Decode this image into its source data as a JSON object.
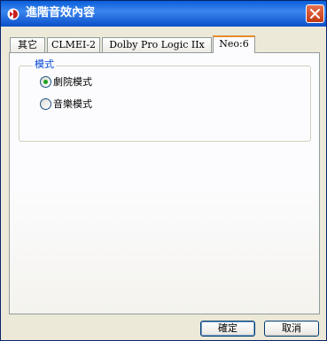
{
  "window": {
    "title": "進階音效內容"
  },
  "tabs": [
    {
      "label": "其它",
      "active": false
    },
    {
      "label": "CLMEI-2",
      "active": false
    },
    {
      "label": "Dolby Pro Logic IIx",
      "active": false
    },
    {
      "label": "Neo:6",
      "active": true
    }
  ],
  "group": {
    "legend": "模式",
    "options": [
      {
        "label": "劇院模式",
        "selected": true
      },
      {
        "label": "音樂模式",
        "selected": false
      }
    ]
  },
  "buttons": {
    "ok": "確定",
    "cancel": "取消"
  },
  "colors": {
    "title_bar": "#0a5fd8",
    "close_button": "#d0542e",
    "active_tab_accent": "#e68b2c",
    "legend_text": "#0046d5",
    "radio_dot": "#21a121"
  }
}
